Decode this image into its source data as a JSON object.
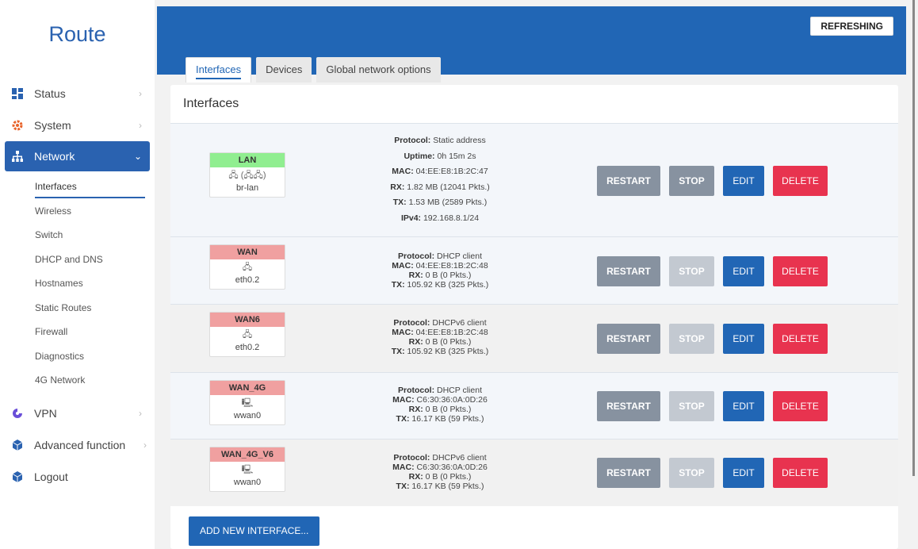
{
  "sidebar": {
    "brand": "Route",
    "items": [
      {
        "label": "Status"
      },
      {
        "label": "System"
      },
      {
        "label": "Network"
      },
      {
        "label": "VPN"
      },
      {
        "label": "Advanced function"
      },
      {
        "label": "Logout"
      }
    ],
    "network_sub": [
      "Interfaces",
      "Wireless",
      "Switch",
      "DHCP and DNS",
      "Hostnames",
      "Static Routes",
      "Firewall",
      "Diagnostics",
      "4G Network"
    ]
  },
  "header": {
    "refresh_label": "REFRESHING",
    "tabs": [
      "Interfaces",
      "Devices",
      "Global network options"
    ]
  },
  "panel": {
    "title": "Interfaces"
  },
  "labels": {
    "protocol": "Protocol:",
    "uptime": "Uptime:",
    "mac": "MAC:",
    "rx": "RX:",
    "tx": "TX:",
    "ipv4": "IPv4:"
  },
  "interfaces": [
    {
      "name": "LAN",
      "status_color": "green",
      "icons": "🖧 (🖧🖧)",
      "device": "br-lan",
      "protocol": "Static address",
      "uptime": "0h 15m 2s",
      "mac": "04:EE:E8:1B:2C:47",
      "rx": "1.82 MB (12041 Pkts.)",
      "tx": "1.53 MB (2589 Pkts.)",
      "ipv4": "192.168.8.1/24",
      "stop_enabled": true
    },
    {
      "name": "WAN",
      "status_color": "red",
      "icons": "🖧",
      "device": "eth0.2",
      "protocol": "DHCP client",
      "mac": "04:EE:E8:1B:2C:48",
      "rx": "0 B (0 Pkts.)",
      "tx": "105.92 KB (325 Pkts.)",
      "stop_enabled": false
    },
    {
      "name": "WAN6",
      "status_color": "red",
      "icons": "🖧",
      "device": "eth0.2",
      "protocol": "DHCPv6 client",
      "mac": "04:EE:E8:1B:2C:48",
      "rx": "0 B (0 Pkts.)",
      "tx": "105.92 KB (325 Pkts.)",
      "stop_enabled": false
    },
    {
      "name": "WAN_4G",
      "status_color": "red",
      "icons": "🖳",
      "device": "wwan0",
      "protocol": "DHCP client",
      "mac": "C6:30:36:0A:0D:26",
      "rx": "0 B (0 Pkts.)",
      "tx": "16.17 KB (59 Pkts.)",
      "stop_enabled": false
    },
    {
      "name": "WAN_4G_V6",
      "status_color": "red",
      "icons": "🖳",
      "device": "wwan0",
      "protocol": "DHCPv6 client",
      "mac": "C6:30:36:0A:0D:26",
      "rx": "0 B (0 Pkts.)",
      "tx": "16.17 KB (59 Pkts.)",
      "stop_enabled": false
    }
  ],
  "buttons": {
    "restart": "RESTART",
    "stop": "STOP",
    "edit": "EDIT",
    "delete": "DELETE",
    "add_new": "ADD NEW INTERFACE..."
  },
  "colors": {
    "primary": "#2166b5",
    "danger": "#e8334f",
    "neutral": "#8792a0",
    "disabled": "#c3c9d1",
    "status_up": "#90ee90",
    "status_down": "#f0a0a0"
  }
}
